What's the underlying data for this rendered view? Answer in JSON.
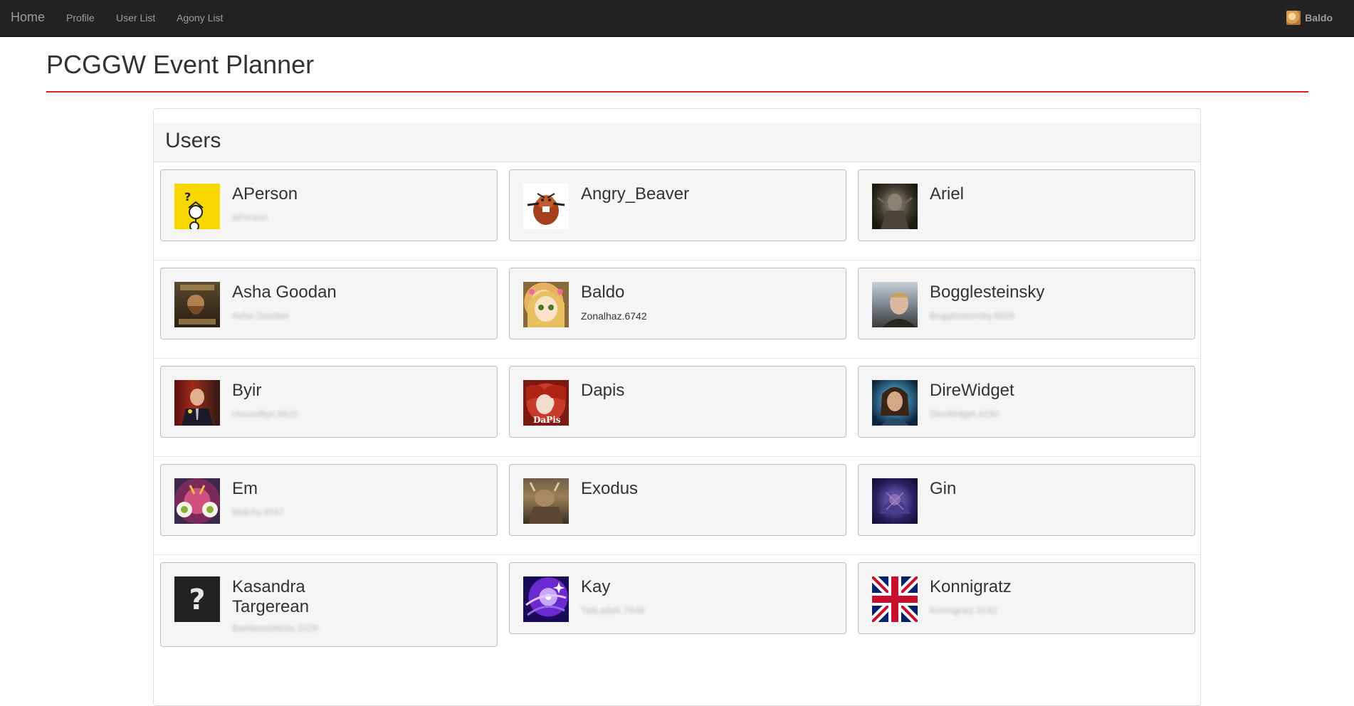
{
  "nav": {
    "brand": "Home",
    "links": [
      "Profile",
      "User List",
      "Agony List"
    ],
    "current_user": "Baldo"
  },
  "page": {
    "title": "PCGGW Event Planner"
  },
  "panel": {
    "heading": "Users"
  },
  "users": [
    {
      "name": "APerson",
      "sub": "APerson",
      "sub_blurred": true,
      "avatar": "question-mark-character-avatar"
    },
    {
      "name": "Angry_Beaver",
      "sub": "",
      "sub_blurred": false,
      "avatar": "beaver-cartoon-avatar"
    },
    {
      "name": "Ariel",
      "sub": "",
      "sub_blurred": false,
      "avatar": "dark-armored-figure-avatar"
    },
    {
      "name": "Asha Goodan",
      "sub": "Asha Goodan",
      "sub_blurred": true,
      "avatar": "dwarf-poster-avatar"
    },
    {
      "name": "Baldo",
      "sub": "Zonalhaz.6742",
      "sub_blurred": false,
      "avatar": "anime-girl-avatar"
    },
    {
      "name": "Bogglesteinsky",
      "sub": "Bogglesteinsky.6928",
      "sub_blurred": true,
      "avatar": "man-portrait-avatar"
    },
    {
      "name": "Byir",
      "sub": "HouseByir.3910",
      "sub_blurred": true,
      "avatar": "man-red-background-avatar"
    },
    {
      "name": "Dapis",
      "sub": "",
      "sub_blurred": false,
      "avatar": "dapis-art-avatar"
    },
    {
      "name": "DireWidget",
      "sub": "DireWidget.4230",
      "sub_blurred": true,
      "avatar": "woman-portrait-avatar"
    },
    {
      "name": "Em",
      "sub": "Malchy.4597",
      "sub_blurred": true,
      "avatar": "purple-creature-avatar"
    },
    {
      "name": "Exodus",
      "sub": "",
      "sub_blurred": false,
      "avatar": "charr-character-avatar"
    },
    {
      "name": "Gin",
      "sub": "",
      "sub_blurred": false,
      "avatar": "purple-fantasy-avatar"
    },
    {
      "name": "Kasandra Targerean",
      "sub": "Bambooslekins.1029",
      "sub_blurred": true,
      "avatar": "question-mark-placeholder-avatar"
    },
    {
      "name": "Kay",
      "sub": "TaliLadyK.7649",
      "sub_blurred": true,
      "avatar": "purple-sparkle-avatar"
    },
    {
      "name": "Konnigratz",
      "sub": "Konnigratz.3142",
      "sub_blurred": true,
      "avatar": "union-jack-flag-avatar"
    }
  ],
  "colors": {
    "navbar_bg": "#222222",
    "nav_text": "#9d9d9d",
    "title_rule": "#d9231d",
    "card_bg": "#f5f5f5",
    "card_border": "#bdbdbd"
  }
}
